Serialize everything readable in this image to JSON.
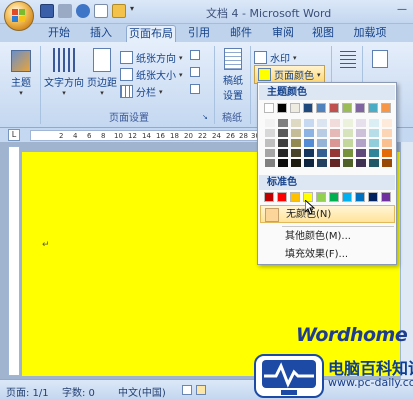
{
  "window": {
    "title": "文档 4 - Microsoft Word"
  },
  "tabs": [
    {
      "label": "开始"
    },
    {
      "label": "插入"
    },
    {
      "label": "页面布局"
    },
    {
      "label": "引用"
    },
    {
      "label": "邮件"
    },
    {
      "label": "审阅"
    },
    {
      "label": "视图"
    },
    {
      "label": "加载项"
    }
  ],
  "ribbon": {
    "themes": {
      "label": "主题"
    },
    "text_direction": {
      "label": "文字方向"
    },
    "margins": {
      "label": "页边距"
    },
    "orientation": {
      "label": "纸张方向"
    },
    "size": {
      "label": "纸张大小"
    },
    "columns": {
      "label": "分栏"
    },
    "page_setup_group": {
      "label": "页面设置"
    },
    "manuscript": {
      "label1": "稿纸",
      "label2": "设置"
    },
    "manuscript_group": {
      "label": "稿纸"
    },
    "watermark": {
      "label": "水印"
    },
    "page_color": {
      "label": "页面颜色"
    }
  },
  "ruler": {
    "corner": "L",
    "ticks": [
      "2",
      "4",
      "6",
      "8",
      "10",
      "12",
      "14",
      "16",
      "18",
      "20",
      "22",
      "24",
      "26",
      "28",
      "30"
    ]
  },
  "page_color_menu": {
    "theme_colors_heading": "主题颜色",
    "standard_colors_heading": "标准色",
    "no_color": "无颜色(N)",
    "more_colors": "其他颜色(M)...",
    "fill_effects": "填充效果(F)..."
  },
  "theme_colors_top": [
    "#ffffff",
    "#000000",
    "#eeece1",
    "#1f497d",
    "#4f81bd",
    "#c0504d",
    "#9bbb59",
    "#8064a2",
    "#4bacc6",
    "#f79646"
  ],
  "theme_shades": [
    [
      "#f2f2f2",
      "#d8d8d8",
      "#bfbfbf",
      "#a5a5a5",
      "#7f7f7f"
    ],
    [
      "#7f7f7f",
      "#595959",
      "#3f3f3f",
      "#262626",
      "#0c0c0c"
    ],
    [
      "#ddd9c3",
      "#c4bd97",
      "#938953",
      "#494429",
      "#1d1b10"
    ],
    [
      "#c6d9f0",
      "#8db3e2",
      "#548dd4",
      "#17365d",
      "#0f243e"
    ],
    [
      "#dbe5f1",
      "#b8cce4",
      "#95b3d7",
      "#366092",
      "#244061"
    ],
    [
      "#f2dcdb",
      "#e5b9b7",
      "#d99694",
      "#953734",
      "#632423"
    ],
    [
      "#ebf1dd",
      "#d7e3bc",
      "#c3d69b",
      "#76923c",
      "#4f6128"
    ],
    [
      "#e5e0ec",
      "#ccc1d9",
      "#b2a2c7",
      "#5f497a",
      "#3f3151"
    ],
    [
      "#dbeef3",
      "#b7dde8",
      "#92cddc",
      "#31859b",
      "#205867"
    ],
    [
      "#fdeada",
      "#fbd5b5",
      "#fac08f",
      "#e36c09",
      "#974806"
    ]
  ],
  "standard_colors": [
    "#c00000",
    "#ff0000",
    "#ffc000",
    "#ffff00",
    "#92d050",
    "#00b050",
    "#00b0f0",
    "#0070c0",
    "#002060",
    "#7030a0"
  ],
  "page": {
    "background": "#ffff00"
  },
  "statusbar": {
    "page": "页面: 1/1",
    "words": "字数: 0",
    "language": "中文(中国)"
  },
  "watermark": {
    "brand": "Wordhome",
    "site_name": "电脑百科知识",
    "site_url": "www.pc-daily.com"
  }
}
